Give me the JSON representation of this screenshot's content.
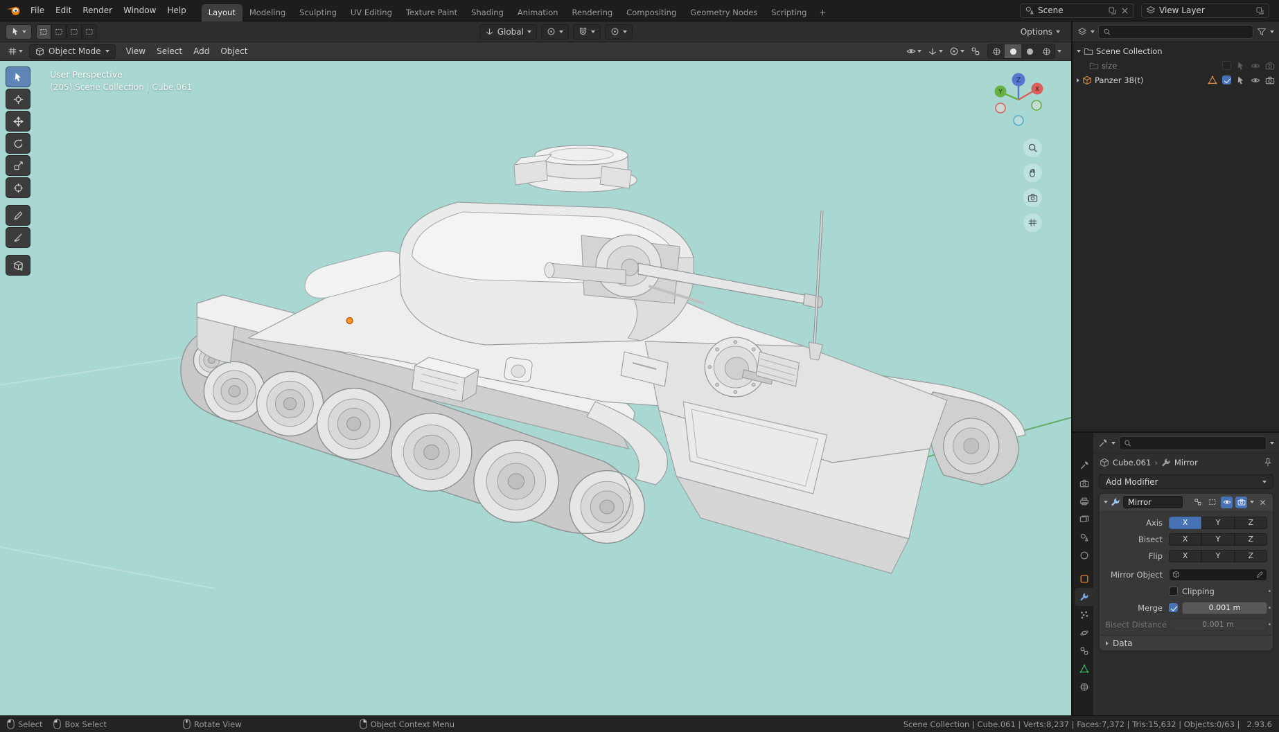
{
  "colors": {
    "accent_blue": "#4772b3",
    "viewport_background": "#a9d8d2",
    "object_origin_orange": "#ff9429",
    "outliner_object_orange": "#dd8d3e"
  },
  "topbar": {
    "menus": [
      "File",
      "Edit",
      "Render",
      "Window",
      "Help"
    ],
    "workspaces": [
      "Layout",
      "Modeling",
      "Sculpting",
      "UV Editing",
      "Texture Paint",
      "Shading",
      "Animation",
      "Rendering",
      "Compositing",
      "Geometry Nodes",
      "Scripting"
    ],
    "add_workspace_label": "+",
    "scene_label": "Scene",
    "view_layer_label": "View Layer"
  },
  "tool_settings": {
    "orientation_label": "Global",
    "options_label": "Options"
  },
  "viewport": {
    "mode_label": "Object Mode",
    "menus": [
      "View",
      "Select",
      "Add",
      "Object"
    ],
    "overlay_line1": "User Perspective",
    "overlay_line2": "(205) Scene Collection | Cube.061",
    "axis_x": "X",
    "axis_y": "Y",
    "axis_z": "Z"
  },
  "outliner": {
    "scene_collection_label": "Scene Collection",
    "item_size_label": "size",
    "item_object_label": "Panzer 38(t)"
  },
  "properties": {
    "breadcrumb_object": "Cube.061",
    "breadcrumb_separator": "›",
    "breadcrumb_modifier": "Mirror",
    "add_modifier_label": "Add Modifier",
    "modifier_name": "Mirror",
    "axis_label": "Axis",
    "bisect_label": "Bisect",
    "flip_label": "Flip",
    "btn_x": "X",
    "btn_y": "Y",
    "btn_z": "Z",
    "mirror_object_label": "Mirror Object",
    "clipping_label": "Clipping",
    "merge_label": "Merge",
    "merge_value": "0.001 m",
    "bisect_distance_label": "Bisect Distance",
    "bisect_distance_value": "0.001 m",
    "data_label": "Data"
  },
  "statusbar": {
    "hint_select": "Select",
    "hint_box_select": "Box Select",
    "hint_rotate": "Rotate View",
    "hint_context": "Object Context Menu",
    "stats": "Scene Collection | Cube.061 | Verts:8,237 | Faces:7,372 | Tris:15,632 | Objects:0/63 |",
    "version": "2.93.6"
  }
}
